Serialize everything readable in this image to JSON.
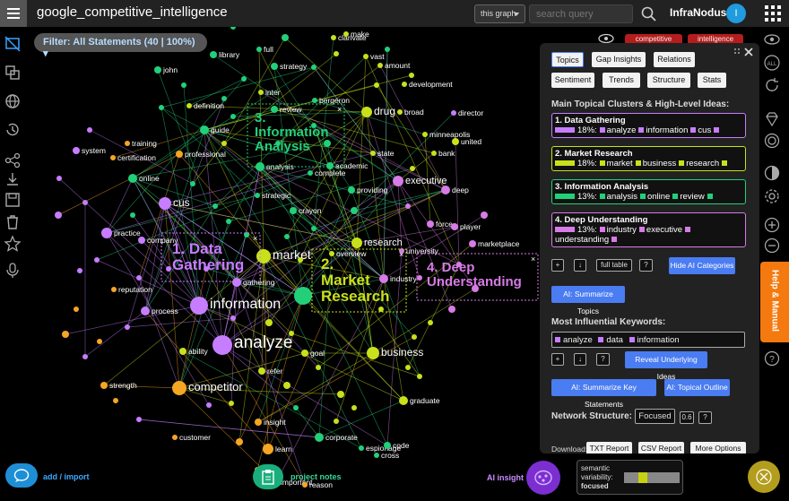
{
  "app": {
    "graph_name": "google_competitive_intelligence",
    "brand": "InfraNodus",
    "user_initial": "I"
  },
  "toolbar": {
    "graph_select": "this graph",
    "search_placeholder": "search query"
  },
  "filter": {
    "label": "Filter: All Statements (40 | 100%)"
  },
  "top_tags": [
    "competitive",
    "intelligence"
  ],
  "graph": {
    "clusters": [
      {
        "label": "1. Data\nGathering",
        "color": "#c77dff"
      },
      {
        "label": "2.\nMarket\nResearch",
        "color": "#c8e11b"
      },
      {
        "label": "3.\nInformation\nAnalysis",
        "color": "#22d07a"
      },
      {
        "label": "4. Deep\nUnderstanding",
        "color": "#d77be6"
      }
    ],
    "nodes": [
      "clarivate",
      "make",
      "vast",
      "amount",
      "library",
      "full",
      "strategy",
      "john",
      "development",
      "inter",
      "bergeron",
      "review",
      "drug",
      "broad",
      "director",
      "definition",
      "guide",
      "professional",
      "minneapolis",
      "united",
      "system",
      "training",
      "certification",
      "state",
      "bank",
      "analysis",
      "academic",
      "complete",
      "executive",
      "deep",
      "online",
      "providing",
      "cus",
      "strategic",
      "crayon",
      "force",
      "player",
      "practice",
      "company",
      "research",
      "university",
      "marketplace",
      "market",
      "overview",
      "industry",
      "gathering",
      "reputation",
      "process",
      "information",
      "analyze",
      "ability",
      "goal",
      "business",
      "refer",
      "strength",
      "competitor",
      "graduate",
      "insight",
      "customer",
      "corporate",
      "learn",
      "espionage",
      "code",
      "cross",
      "important",
      "reason"
    ]
  },
  "panel": {
    "tabs": [
      "Topics",
      "Gap Insights",
      "Relations"
    ],
    "tabs2": [
      "Sentiment",
      "Trends",
      "Structure",
      "Stats"
    ],
    "topics_heading": "Main Topical Clusters & High-Level Ideas:",
    "topics": [
      {
        "title": "1. Data Gathering",
        "pct": "18%:",
        "words": [
          "analyze",
          "information",
          "cus"
        ],
        "color": "#c77dff"
      },
      {
        "title": "2. Market Research",
        "pct": "18%:",
        "words": [
          "market",
          "business",
          "research"
        ],
        "color": "#c8e11b"
      },
      {
        "title": "3. Information Analysis",
        "pct": "13%:",
        "words": [
          "analysis",
          "online",
          "review"
        ],
        "color": "#22d07a"
      },
      {
        "title": "4. Deep Understanding",
        "pct": "13%:",
        "words": [
          "industry",
          "executive",
          "understanding"
        ],
        "color": "#d77be6"
      }
    ],
    "controls1": {
      "plus": "+",
      "down": "↓",
      "full_table": "full table",
      "help": "?",
      "hide": "Hide AI Categories"
    },
    "summarize_topics": "AI: Summarize Topics",
    "keywords_heading": "Most Influential Keywords:",
    "keywords": [
      "analyze",
      "data",
      "information"
    ],
    "controls2": {
      "plus": "+",
      "down": "↓",
      "help": "?",
      "reveal": "Reveal Underlying Ideas"
    },
    "summarize_statements": "AI: Summarize Key Statements",
    "topical_outline": "AI: Topical Outline",
    "structure_label": "Network Structure:",
    "structure_value": "Focused",
    "structure_score": "0.6",
    "structure_help": "?",
    "download_label": "Download:",
    "downloads": [
      "TXT Report",
      "CSV Report",
      "More Options"
    ]
  },
  "help_tab": "Help & Manual",
  "bottom": {
    "add_import": "add / import",
    "project_notes": "project notes",
    "ai_insight": "AI insight",
    "semantic_label_1": "semantic",
    "semantic_label_2": "variability:",
    "semantic_value": "focused"
  }
}
